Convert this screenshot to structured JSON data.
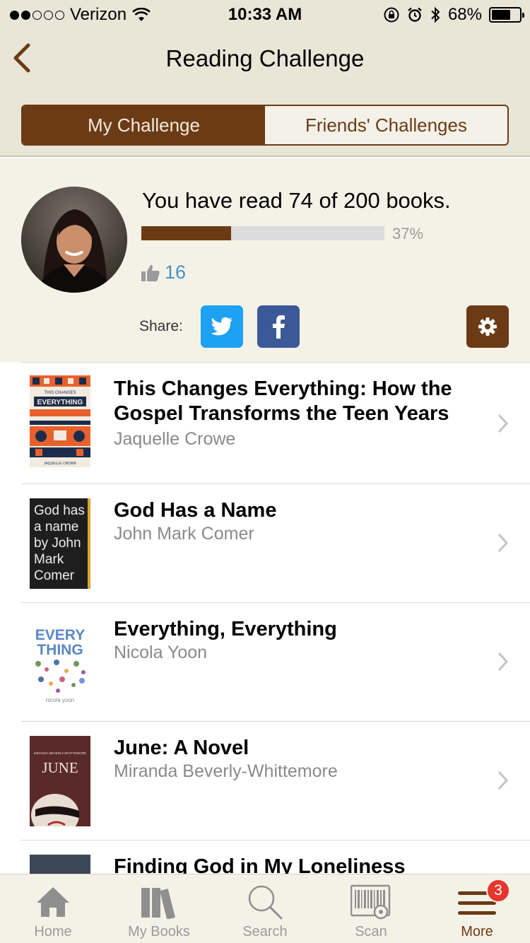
{
  "status_bar": {
    "carrier": "Verizon",
    "time": "10:33 AM",
    "battery": "68%",
    "battery_level": 0.68,
    "signal_bars_filled": 2,
    "signal_bars_total": 5
  },
  "nav": {
    "title": "Reading Challenge",
    "back_icon": "chevron-left-icon"
  },
  "segments": {
    "my_challenge": "My Challenge",
    "friends_challenges": "Friends' Challenges",
    "selected": "My Challenge"
  },
  "challenge": {
    "summary": "You have read 74 of 200 books.",
    "books_read": 74,
    "books_goal": 200,
    "progress_fraction": 0.37,
    "percent_label": "37%",
    "likes": "16",
    "share_label": "Share:"
  },
  "colors": {
    "brand_brown": "#6b3b16",
    "header_bg": "#e9e6d8",
    "profile_bg": "#f4f2e7",
    "twitter_blue": "#1da1f2",
    "facebook_blue": "#3b5998",
    "likes_blue": "#4a90c8",
    "badge_red": "#e8352d"
  },
  "books": [
    {
      "title": "This Changes Everything: How the Gospel Transforms the Teen Years",
      "author": "Jaquelle Crowe"
    },
    {
      "title": "God Has a Name",
      "author": "John Mark Comer"
    },
    {
      "title": "Everything, Everything",
      "author": "Nicola Yoon"
    },
    {
      "title": "June: A Novel",
      "author": "Miranda Beverly-Whittemore"
    },
    {
      "title": "Finding God in My Loneliness",
      "author": ""
    }
  ],
  "covers": {
    "c1_top": "THIS CHANGES",
    "c1_main": "EVERYTHING",
    "c1_author": "JAQUELLE CROWE",
    "c2_text": "God has a name by John Mark Comer",
    "c3_line1": "EVERY",
    "c3_line2": "THING",
    "c3_author": "nicola yoon",
    "c4_top": "MIRANDA BEVERLY-WHITTEMORE",
    "c4_main": "JUNE"
  },
  "tabs": [
    {
      "label": "Home",
      "icon": "home-icon"
    },
    {
      "label": "My Books",
      "icon": "books-icon"
    },
    {
      "label": "Search",
      "icon": "search-icon"
    },
    {
      "label": "Scan",
      "icon": "barcode-scan-icon"
    },
    {
      "label": "More",
      "icon": "menu-icon",
      "badge": "3",
      "active": true
    }
  ]
}
